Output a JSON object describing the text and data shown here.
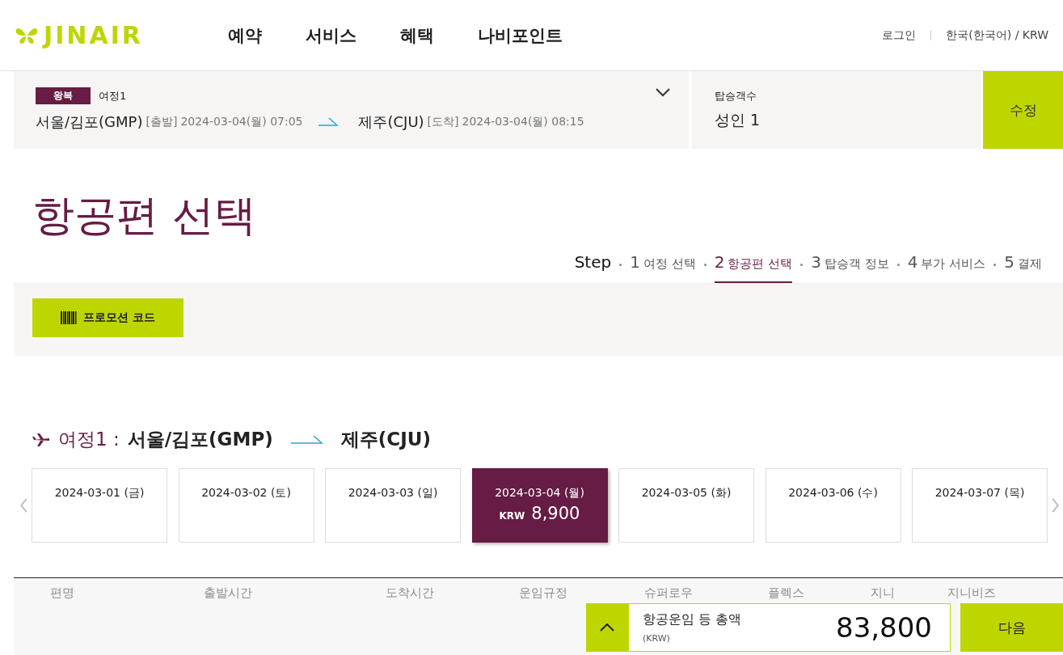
{
  "header": {
    "logo": "JINAIR",
    "nav": [
      "예약",
      "서비스",
      "혜택",
      "나비포인트"
    ],
    "utility": [
      "로그인",
      "한국(한국어) / KRW"
    ]
  },
  "summary": {
    "trip_type": "왕복",
    "trip_label": "여정1",
    "origin": "서울/김포(GMP)",
    "depart_tag": "[출발]",
    "depart_time": "2024-03-04(월) 07:05",
    "destination": "제주(CJU)",
    "arrive_tag": "[도착]",
    "arrive_time": "2024-03-04(월) 08:15",
    "passengers_label": "탑승객수",
    "passengers": "성인 1",
    "edit_button": "수정"
  },
  "page_title": "항공편 선택",
  "steps": {
    "label": "Step",
    "items": [
      {
        "number": "1",
        "label": "여정 선택",
        "selected": false
      },
      {
        "number": "2",
        "label": "항공편 선택",
        "selected": true
      },
      {
        "number": "3",
        "label": "탑승객 정보",
        "selected": false
      },
      {
        "number": "4",
        "label": "부가 서비스",
        "selected": false
      },
      {
        "number": "5",
        "label": "결제",
        "selected": false
      }
    ]
  },
  "promo_button": "프로모션 코드",
  "itinerary": {
    "label": "여정1 :",
    "origin": "서울/김포(GMP)",
    "destination": "제주(CJU)"
  },
  "dates": [
    {
      "date": "2024-03-01 (금)",
      "selected": false
    },
    {
      "date": "2024-03-02 (토)",
      "selected": false
    },
    {
      "date": "2024-03-03 (일)",
      "selected": false
    },
    {
      "date": "2024-03-04 (월)",
      "selected": true,
      "currency": "KRW",
      "price": "8,900"
    },
    {
      "date": "2024-03-05 (화)",
      "selected": false
    },
    {
      "date": "2024-03-06 (수)",
      "selected": false
    },
    {
      "date": "2024-03-07 (목)",
      "selected": false
    }
  ],
  "table": {
    "columns": [
      "편명",
      "출발시간",
      "도착시간",
      "운임규정",
      "슈퍼로우",
      "플렉스",
      "지니",
      "지니비즈"
    ]
  },
  "total_bar": {
    "label": "항공운임 등 총액",
    "currency": "(KRW)",
    "amount": "83,800",
    "next_button": "다음"
  }
}
